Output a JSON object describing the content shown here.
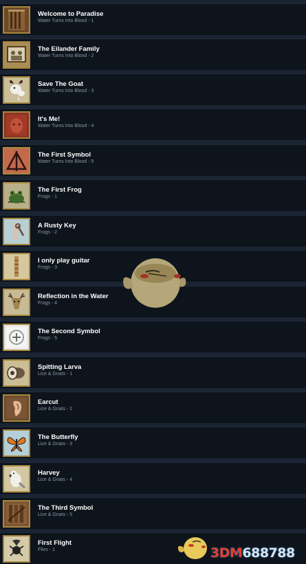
{
  "achievements": [
    {
      "title": "Welcome to Paradise",
      "chapter": "Water Turns Into Blood - 1",
      "icon": "wooden-door-icon"
    },
    {
      "title": "The Eilander Family",
      "chapter": "Water Turns Into Blood - 2",
      "icon": "family-portrait-icon"
    },
    {
      "title": "Save The Goat",
      "chapter": "Water Turns Into Blood - 3",
      "icon": "goat-icon"
    },
    {
      "title": "It's Me!",
      "chapter": "Water Turns Into Blood - 4",
      "icon": "bloody-face-icon"
    },
    {
      "title": "The First Symbol",
      "chapter": "Water Turns Into Blood - 5",
      "icon": "first-symbol-icon"
    },
    {
      "title": "The First Frog",
      "chapter": "Frogs - 1",
      "icon": "frog-icon"
    },
    {
      "title": "A Rusty Key",
      "chapter": "Frogs - 2",
      "icon": "rusty-key-icon"
    },
    {
      "title": "I only play guitar",
      "chapter": "Frogs - 3",
      "icon": "guitar-neck-icon"
    },
    {
      "title": "Reflection in the Water",
      "chapter": "Frogs - 4",
      "icon": "deer-head-icon"
    },
    {
      "title": "The Second Symbol",
      "chapter": "Frogs - 5",
      "icon": "second-symbol-icon"
    },
    {
      "title": "Spitting Larva",
      "chapter": "Lice & Gnats - 1",
      "icon": "larva-icon"
    },
    {
      "title": "Earcut",
      "chapter": "Lice & Gnats - 2",
      "icon": "ear-icon"
    },
    {
      "title": "The Butterfly",
      "chapter": "Lice & Gnats - 3",
      "icon": "butterfly-icon"
    },
    {
      "title": "Harvey",
      "chapter": "Lice & Gnats - 4",
      "icon": "parrot-icon"
    },
    {
      "title": "The Third Symbol",
      "chapter": "Lice & Gnats - 5",
      "icon": "third-symbol-icon"
    },
    {
      "title": "First Flight",
      "chapter": "Flies - 1",
      "icon": "fly-icon"
    }
  ],
  "watermark": {
    "site": "3DM",
    "domain": "688788"
  },
  "colors": {
    "row_bg": "#0e141c",
    "page_bg": "#1b2432",
    "title": "#ffffff",
    "subtitle": "#8a97a6",
    "icon_frame": "#a8883d"
  }
}
